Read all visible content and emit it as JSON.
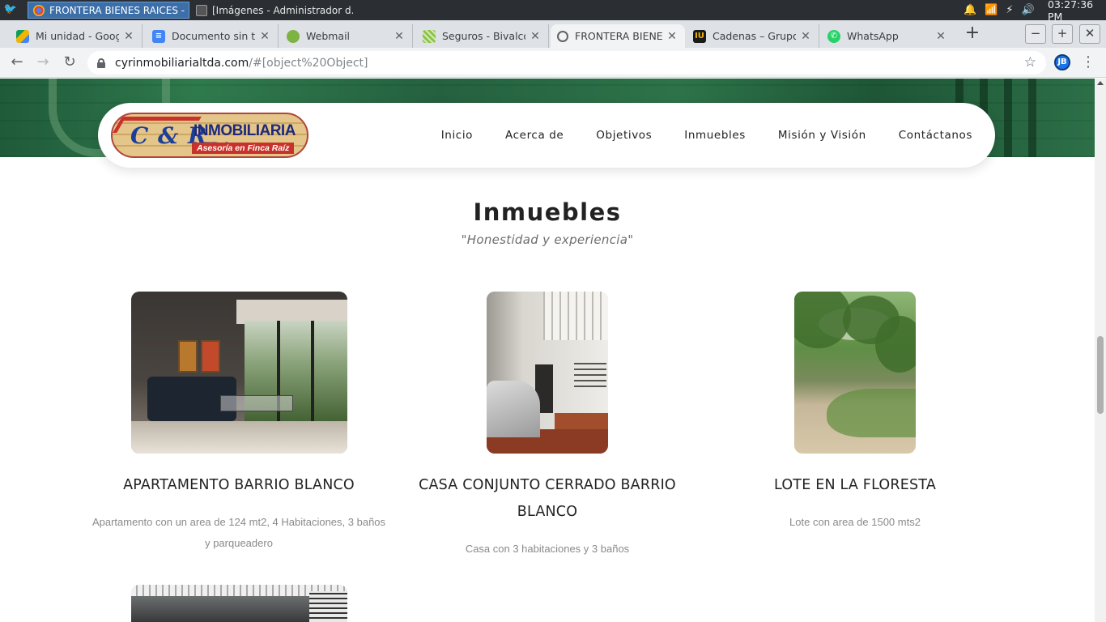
{
  "os": {
    "tasks": [
      {
        "label": "FRONTERA BIENES RAICES - ...",
        "active": true
      },
      {
        "label": "[Imágenes - Administrador d...",
        "active": false
      }
    ],
    "clock": "03:27:36 PM"
  },
  "browser": {
    "tabs": [
      {
        "label": "Mi unidad - Google",
        "icon": "google-drive-icon",
        "color": "#f4b400"
      },
      {
        "label": "Documento sin títu",
        "icon": "google-docs-icon",
        "color": "#4285f4"
      },
      {
        "label": "Webmail",
        "icon": "webmail-icon",
        "color": "#7cb342"
      },
      {
        "label": "Seguros - Bivalco",
        "icon": "bivalco-icon",
        "color": "#8bc34a"
      },
      {
        "label": "FRONTERA BIENES RAI",
        "icon": "globe-icon",
        "color": "#5f6368",
        "active": true
      },
      {
        "label": "Cadenas – Grupo I",
        "icon": "cadenas-icon",
        "color": "#1a1a1a"
      },
      {
        "label": "WhatsApp",
        "icon": "whatsapp-icon",
        "color": "#25d366"
      }
    ],
    "url_host": "cyrinmobiliarialtda.com",
    "url_path": "/#[object%20Object]",
    "profile_initials": "JB"
  },
  "site": {
    "logo": {
      "initials": "C & R",
      "name": "INMOBILIARIA LTDA.",
      "tagline": "Asesoría en Finca Raíz"
    },
    "nav": [
      "Inicio",
      "Acerca de",
      "Objetivos",
      "Inmuebles",
      "Misión y Visión",
      "Contáctanos"
    ],
    "section": {
      "title": "Inmuebles",
      "subtitle": "\"Honestidad y experiencia\""
    },
    "listings": [
      {
        "title": "APARTAMENTO BARRIO BLANCO",
        "description": "Apartamento con un area de 124 mt2, 4 Habitaciones, 3 baños y parqueadero"
      },
      {
        "title": "CASA CONJUNTO CERRADO BARRIO BLANCO",
        "description": "Casa con 3 habitaciones y 3 baños"
      },
      {
        "title": "LOTE EN LA FLORESTA",
        "description": "Lote con area de 1500 mts2"
      }
    ]
  }
}
